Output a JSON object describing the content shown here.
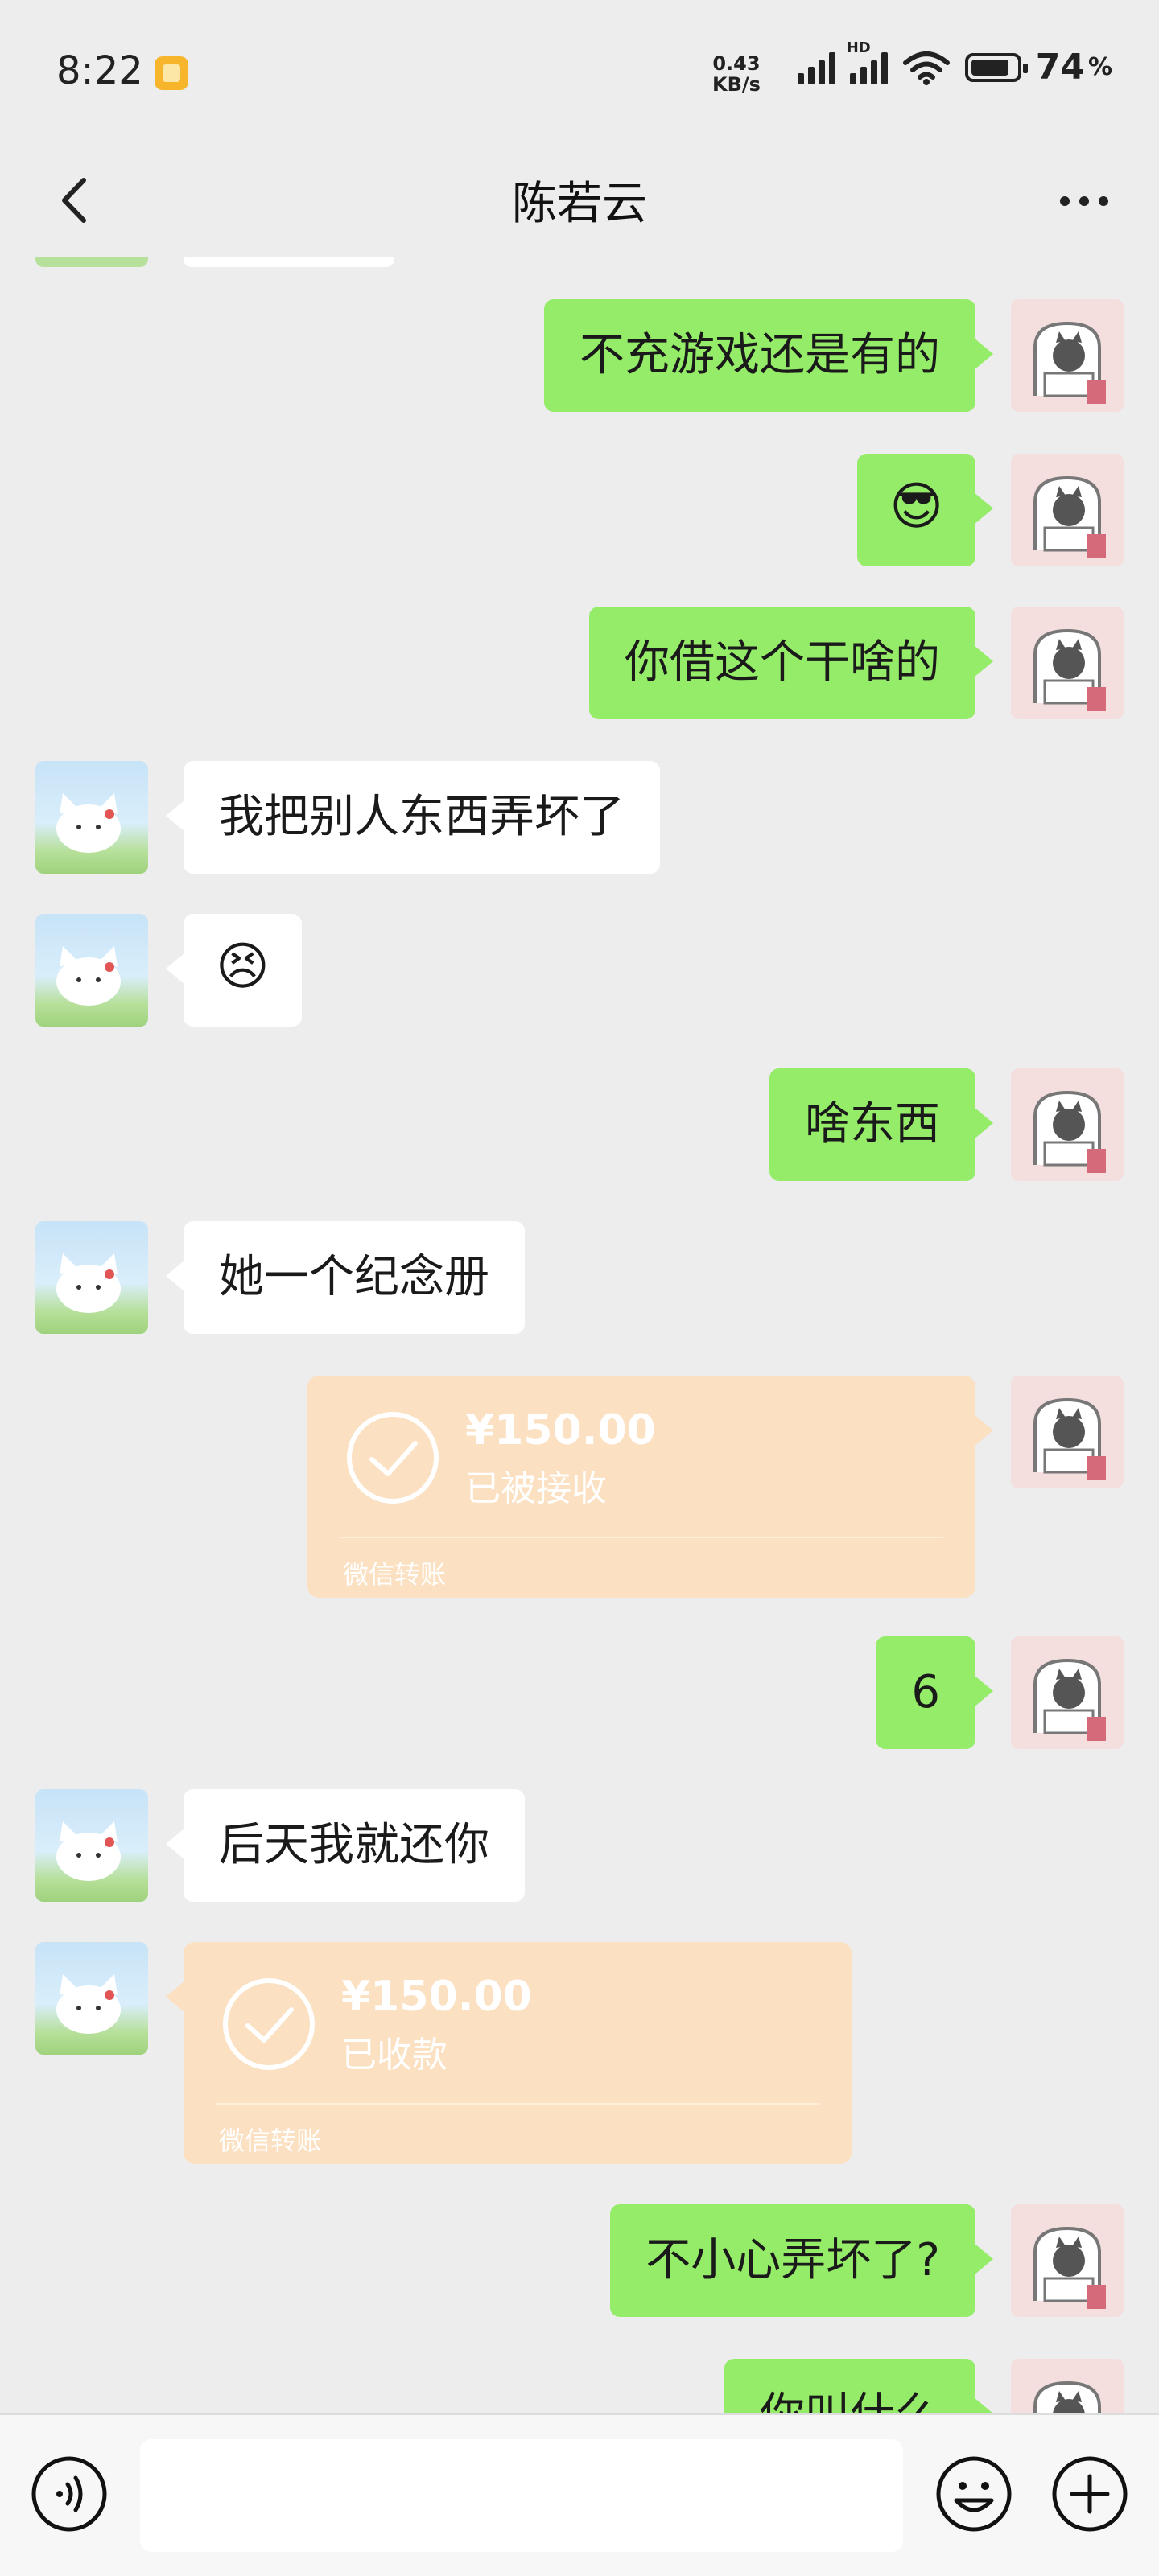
{
  "status_bar": {
    "time": "8:22",
    "net_speed_value": "0.43",
    "net_speed_unit": "KB/s",
    "signal_label": "HD",
    "battery": "74",
    "battery_unit": "%"
  },
  "header": {
    "title": "陈若云"
  },
  "messages": [
    {
      "side": "me",
      "type": "text",
      "text": "不充游戏还是有的"
    },
    {
      "side": "me",
      "type": "emoji",
      "text": "😎"
    },
    {
      "side": "me",
      "type": "text",
      "text": "你借这个干啥的"
    },
    {
      "side": "them",
      "type": "text",
      "text": "我把别人东西弄坏了"
    },
    {
      "side": "them",
      "type": "emoji",
      "text": "😣"
    },
    {
      "side": "me",
      "type": "text",
      "text": "啥东西"
    },
    {
      "side": "them",
      "type": "text",
      "text": "她一个纪念册"
    },
    {
      "side": "me",
      "type": "transfer",
      "amount": "¥150.00",
      "status": "已被接收",
      "footer": "微信转账"
    },
    {
      "side": "me",
      "type": "text",
      "text": "6"
    },
    {
      "side": "them",
      "type": "text",
      "text": "后天我就还你"
    },
    {
      "side": "them",
      "type": "transfer",
      "amount": "¥150.00",
      "status": "已收款",
      "footer": "微信转账"
    },
    {
      "side": "me",
      "type": "text",
      "text": "不小心弄坏了?"
    },
    {
      "side": "me",
      "type": "text",
      "text": "你叫什么"
    }
  ],
  "colors": {
    "background": "#ededed",
    "my_bubble": "#95ec69",
    "their_bubble": "#ffffff",
    "transfer_card": "#fbe0c2"
  },
  "icons": {
    "back": "chevron-left-icon",
    "more": "more-dots-icon",
    "voice": "voice-icon",
    "emoji": "emoji-icon",
    "plus": "plus-icon"
  }
}
